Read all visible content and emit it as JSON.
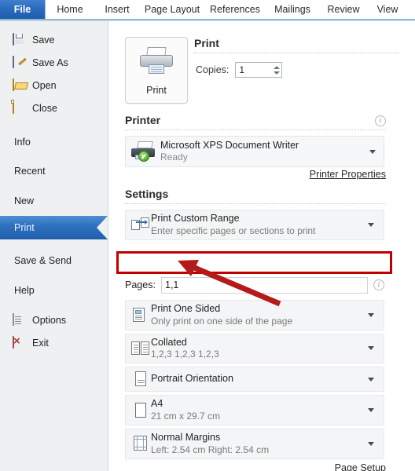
{
  "app": {
    "title": "Microsoft Word 2010 - Backstage Print view"
  },
  "ribbon": {
    "file_tab": "File",
    "tabs": [
      {
        "label": "Home"
      },
      {
        "label": "Insert"
      },
      {
        "label": "Page Layout"
      },
      {
        "label": "References"
      },
      {
        "label": "Mailings"
      },
      {
        "label": "Review"
      },
      {
        "label": "View"
      }
    ]
  },
  "sidebar": {
    "items": [
      {
        "label": "Save",
        "icon": "floppy-disk-icon",
        "selected": false,
        "has_icon": true
      },
      {
        "label": "Save As",
        "icon": "save-as-icon",
        "selected": false,
        "has_icon": true
      },
      {
        "label": "Open",
        "icon": "open-folder-icon",
        "selected": false,
        "has_icon": true
      },
      {
        "label": "Close",
        "icon": "close-folder-icon",
        "selected": false,
        "has_icon": true
      },
      {
        "label": "Info",
        "icon": "",
        "selected": false,
        "has_icon": false
      },
      {
        "label": "Recent",
        "icon": "",
        "selected": false,
        "has_icon": false
      },
      {
        "label": "New",
        "icon": "",
        "selected": false,
        "has_icon": false
      },
      {
        "label": "Print",
        "icon": "",
        "selected": true,
        "has_icon": false
      },
      {
        "label": "Save & Send",
        "icon": "",
        "selected": false,
        "has_icon": false
      },
      {
        "label": "Help",
        "icon": "",
        "selected": false,
        "has_icon": false
      },
      {
        "label": "Options",
        "icon": "options-icon",
        "selected": false,
        "has_icon": true
      },
      {
        "label": "Exit",
        "icon": "exit-icon",
        "selected": false,
        "has_icon": true
      }
    ]
  },
  "print": {
    "heading": "Print",
    "button_label": "Print",
    "button_icon": "printer-icon",
    "copies_label": "Copies:",
    "copies_value": "1"
  },
  "printer": {
    "heading": "Printer",
    "name": "Microsoft XPS Document Writer",
    "status": "Ready",
    "icon": "printer-ready-icon",
    "properties_link": "Printer Properties",
    "info_icon": "info-icon"
  },
  "settings": {
    "heading": "Settings",
    "range": {
      "title": "Print Custom Range",
      "subtitle": "Enter specific pages or sections to print",
      "icon": "custom-range-icon"
    },
    "pages": {
      "label": "Pages:",
      "value": "1,1",
      "placeholder": "",
      "info_icon": "info-icon"
    },
    "rows": [
      {
        "title": "Print One Sided",
        "subtitle": "Only print on one side of the page",
        "icon": "one-sided-icon"
      },
      {
        "title": "Collated",
        "subtitle": "1,2,3   1,2,3   1,2,3",
        "icon": "collated-icon"
      },
      {
        "title": "Portrait Orientation",
        "subtitle": "",
        "icon": "portrait-icon"
      },
      {
        "title": "A4",
        "subtitle": "21 cm x 29.7 cm",
        "icon": "paper-size-icon"
      },
      {
        "title": "Normal Margins",
        "subtitle": "Left:  2.54 cm   Right:  2.54 cm",
        "icon": "margins-icon"
      }
    ],
    "page_setup_link": "Page Setup"
  },
  "annotation": {
    "highlight_color": "#c00000",
    "arrow_color": "#b51a1a",
    "target": "pages-input"
  }
}
